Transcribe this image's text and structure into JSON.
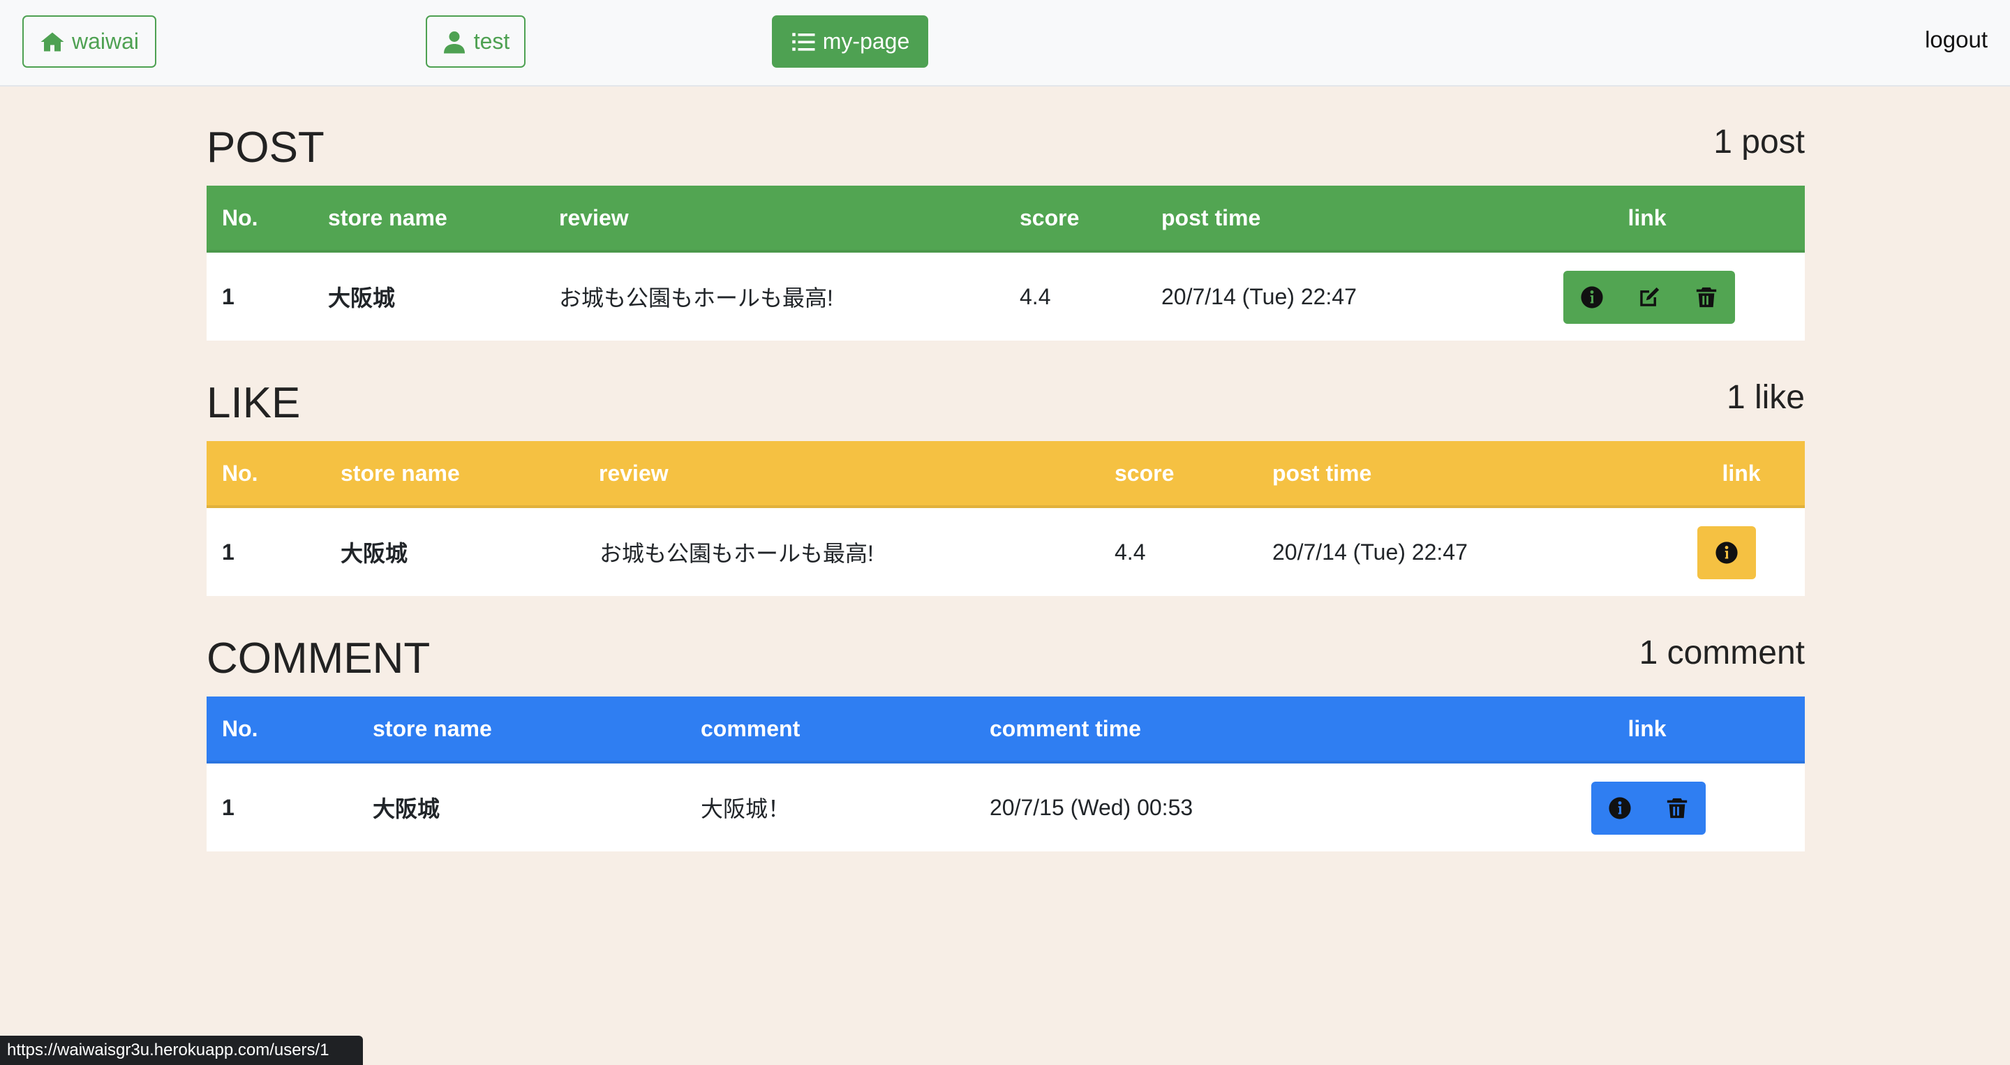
{
  "nav": {
    "home_label": "waiwai",
    "user_label": "test",
    "mypage_label": "my-page",
    "logout_label": "logout"
  },
  "post": {
    "title": "POST",
    "count": "1 post",
    "headers": [
      "No.",
      "store name",
      "review",
      "score",
      "post time",
      "link"
    ],
    "rows": [
      {
        "no": "1",
        "store": "大阪城",
        "review": "お城も公園もホールも最高!",
        "score": "4.4",
        "time": "20/7/14 (Tue) 22:47"
      }
    ]
  },
  "like": {
    "title": "LIKE",
    "count": "1 like",
    "headers": [
      "No.",
      "store name",
      "review",
      "score",
      "post time",
      "link"
    ],
    "rows": [
      {
        "no": "1",
        "store": "大阪城",
        "review": "お城も公園もホールも最高!",
        "score": "4.4",
        "time": "20/7/14 (Tue) 22:47"
      }
    ]
  },
  "comment": {
    "title": "COMMENT",
    "count": "1 comment",
    "headers": [
      "No.",
      "store name",
      "comment",
      "comment time",
      "link"
    ],
    "rows": [
      {
        "no": "1",
        "store": "大阪城",
        "comment": "大阪城！",
        "time": "20/7/15 (Wed) 00:53"
      }
    ]
  },
  "status_url": "https://waiwaisgr3u.herokuapp.com/users/1",
  "colors": {
    "green": "#52a552",
    "yellow": "#f5c142",
    "blue": "#2f7ef2",
    "background": "#f7eee6"
  }
}
